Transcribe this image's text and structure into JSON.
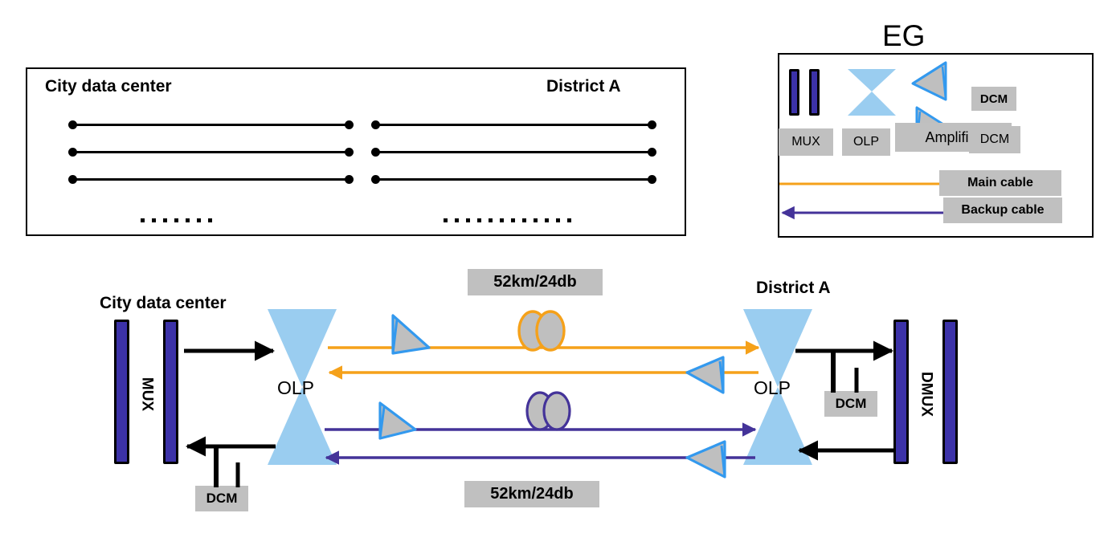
{
  "topology_box": {
    "left_title": "City data center",
    "right_title": "District  A",
    "left_ellipsis_dots": 7,
    "right_ellipsis_dots": 12,
    "link_rows": 3
  },
  "legend": {
    "title": "EG",
    "items": [
      {
        "label": "MUX",
        "symbol": "mux-bars-icon"
      },
      {
        "label": "OLP",
        "symbol": "olp-bowtie-icon"
      },
      {
        "label": "Amplifier",
        "symbol": "amplifier-triangles-icon"
      },
      {
        "label": "DCM",
        "symbol": "dcm-box-icon"
      },
      {
        "label": "DCM",
        "symbol": "dcm-chip-icon"
      },
      {
        "label": "Main cable",
        "symbol": "orange-line-icon"
      },
      {
        "label": "Backup cable",
        "symbol": "purple-arrow-icon"
      }
    ]
  },
  "diagram": {
    "left_site_title": "City data center",
    "right_site_title": "District A",
    "left_mux_label": "MUX",
    "right_mux_label": "DMUX",
    "left_olp_label": "OLP",
    "right_olp_label": "OLP",
    "left_dcm_label": "DCM",
    "right_dcm_label": "DCM",
    "span_label_top": "52km/24db",
    "span_label_bottom": "52km/24db"
  },
  "colors": {
    "main_cable": "#f5a11a",
    "backup_cable": "#443399",
    "olp_fill": "#9acdf0",
    "mux_fill": "#3c32a8",
    "amplifier_fill": "#bfbfbf",
    "amplifier_stroke": "#3399ee",
    "tag_bg": "#c0c0c0",
    "line_black": "#000000"
  }
}
